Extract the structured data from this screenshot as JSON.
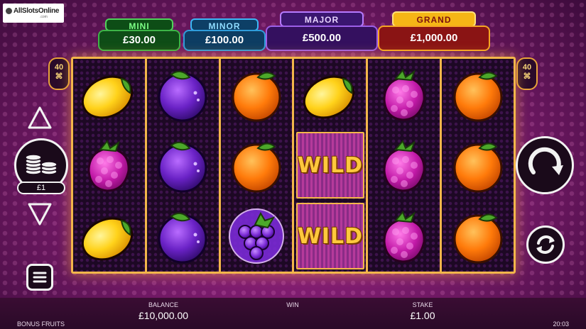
{
  "watermark": {
    "name": "AllSlotsOnline",
    "sub": ".com"
  },
  "jackpots": [
    {
      "label": "MINI",
      "value": "£30.00"
    },
    {
      "label": "MINOR",
      "value": "£100.00"
    },
    {
      "label": "MAJOR",
      "value": "£500.00"
    },
    {
      "label": "GRAND",
      "value": "£1,000.00"
    }
  ],
  "ways": {
    "count": "40",
    "icon": "ways-icon"
  },
  "reels": [
    [
      "lemon",
      "raspberry",
      "lemon"
    ],
    [
      "plum",
      "plum",
      "plum"
    ],
    [
      "orange",
      "orange",
      "grapes"
    ],
    [
      "lemon",
      "wild",
      "wild"
    ],
    [
      "raspberry",
      "raspberry",
      "raspberry"
    ],
    [
      "orange",
      "orange",
      "orange"
    ]
  ],
  "wild_label": "WILD",
  "controls": {
    "coin_value": "£1",
    "up_icon": "triangle-up-icon",
    "down_icon": "triangle-down-icon",
    "menu_icon": "hamburger-menu-icon",
    "spin_icon": "spin-arrow-icon",
    "autoplay_icon": "autoplay-icon"
  },
  "bottom_bar": {
    "balance_label": "BALANCE",
    "balance_value": "£10,000.00",
    "win_label": "WIN",
    "stake_label": "STAKE",
    "stake_value": "£1.00",
    "game_name": "BONUS FRUITS",
    "time": "20:03"
  },
  "colors": {
    "reel_frame": "#f3b64a",
    "mini": "#4fd15a",
    "minor": "#3db7f5",
    "major": "#b67bff",
    "grand": "#f5b616"
  }
}
